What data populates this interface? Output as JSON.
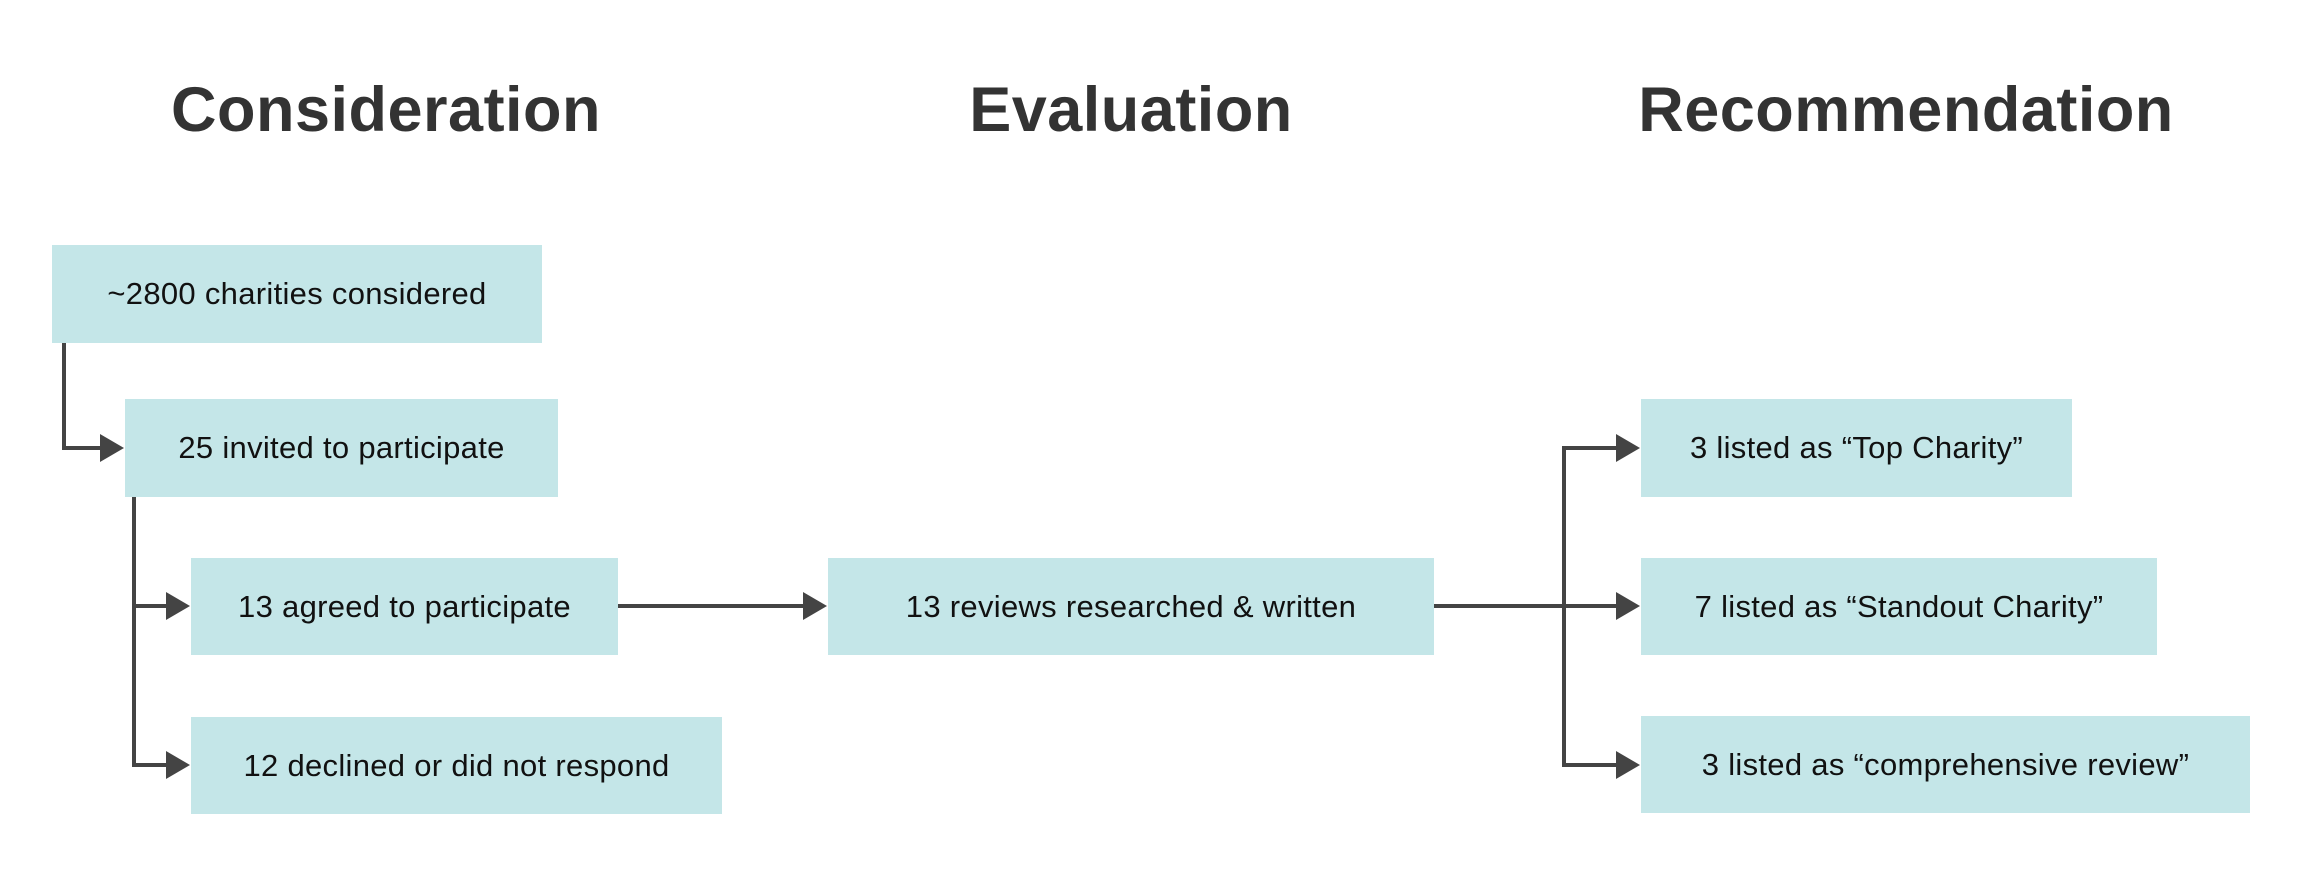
{
  "stages": {
    "consideration": {
      "title": "Consideration"
    },
    "evaluation": {
      "title": "Evaluation"
    },
    "recommendation": {
      "title": "Recommendation"
    }
  },
  "nodes": {
    "considered": {
      "label": "~2800 charities considered",
      "count": 2800
    },
    "invited": {
      "label": "25 invited to participate",
      "count": 25
    },
    "agreed": {
      "label": "13 agreed to participate",
      "count": 13
    },
    "declined": {
      "label": "12 declined or did not respond",
      "count": 12
    },
    "reviews": {
      "label": "13 reviews researched & written",
      "count": 13
    },
    "top_charity": {
      "label": "3 listed as “Top Charity”",
      "count": 3
    },
    "standout_charity": {
      "label": "7 listed as “Standout Charity”",
      "count": 7
    },
    "comprehensive_review": {
      "label": "3 listed as “comprehensive review”",
      "count": 3
    }
  },
  "edges": [
    {
      "from": "considered",
      "to": "invited"
    },
    {
      "from": "invited",
      "to": "agreed"
    },
    {
      "from": "invited",
      "to": "declined"
    },
    {
      "from": "agreed",
      "to": "reviews"
    },
    {
      "from": "reviews",
      "to": "top_charity"
    },
    {
      "from": "reviews",
      "to": "standout_charity"
    },
    {
      "from": "reviews",
      "to": "comprehensive_review"
    }
  ],
  "colors": {
    "node_fill": "#c4e6e8",
    "connector": "#444444",
    "heading_text": "#333333",
    "node_text": "#111111"
  }
}
